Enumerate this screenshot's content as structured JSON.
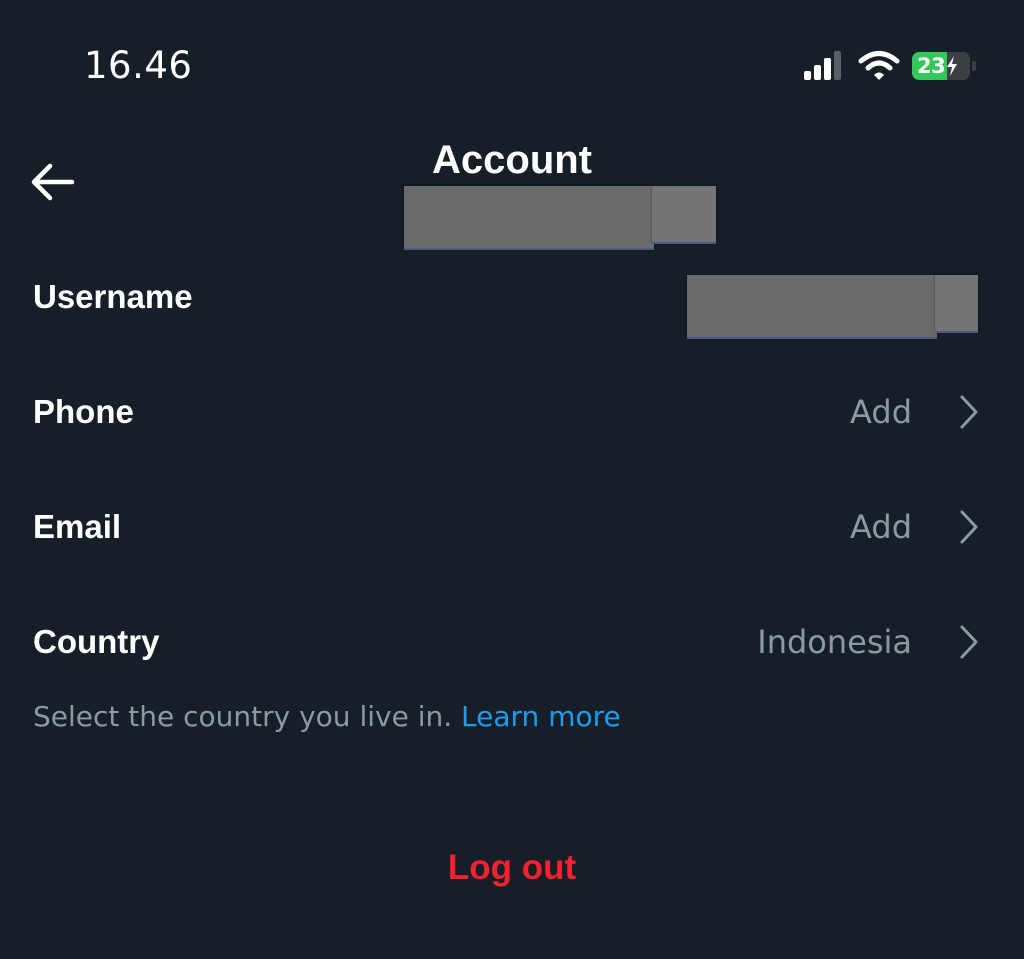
{
  "status_bar": {
    "time": "16.46",
    "battery_level": "23",
    "battery_fill_fraction": 0.23,
    "battery_color": "#34c759",
    "icons": [
      "signal-icon",
      "wifi-icon",
      "battery-icon",
      "bolt-icon"
    ]
  },
  "header": {
    "back_icon": "arrow-left-icon",
    "title": "Account"
  },
  "rows": [
    {
      "label": "Username",
      "value": ""
    },
    {
      "label": "Phone",
      "value": "Add"
    },
    {
      "label": "Email",
      "value": "Add"
    },
    {
      "label": "Country",
      "value": "Indonesia"
    }
  ],
  "country_helper": {
    "text": "Select the country you live in. ",
    "link": "Learn more"
  },
  "logout_label": "Log out",
  "colors": {
    "background": "#161e28",
    "secondary_text": "#8b98a5",
    "link": "#1d9bf0",
    "danger": "#f4212e"
  }
}
